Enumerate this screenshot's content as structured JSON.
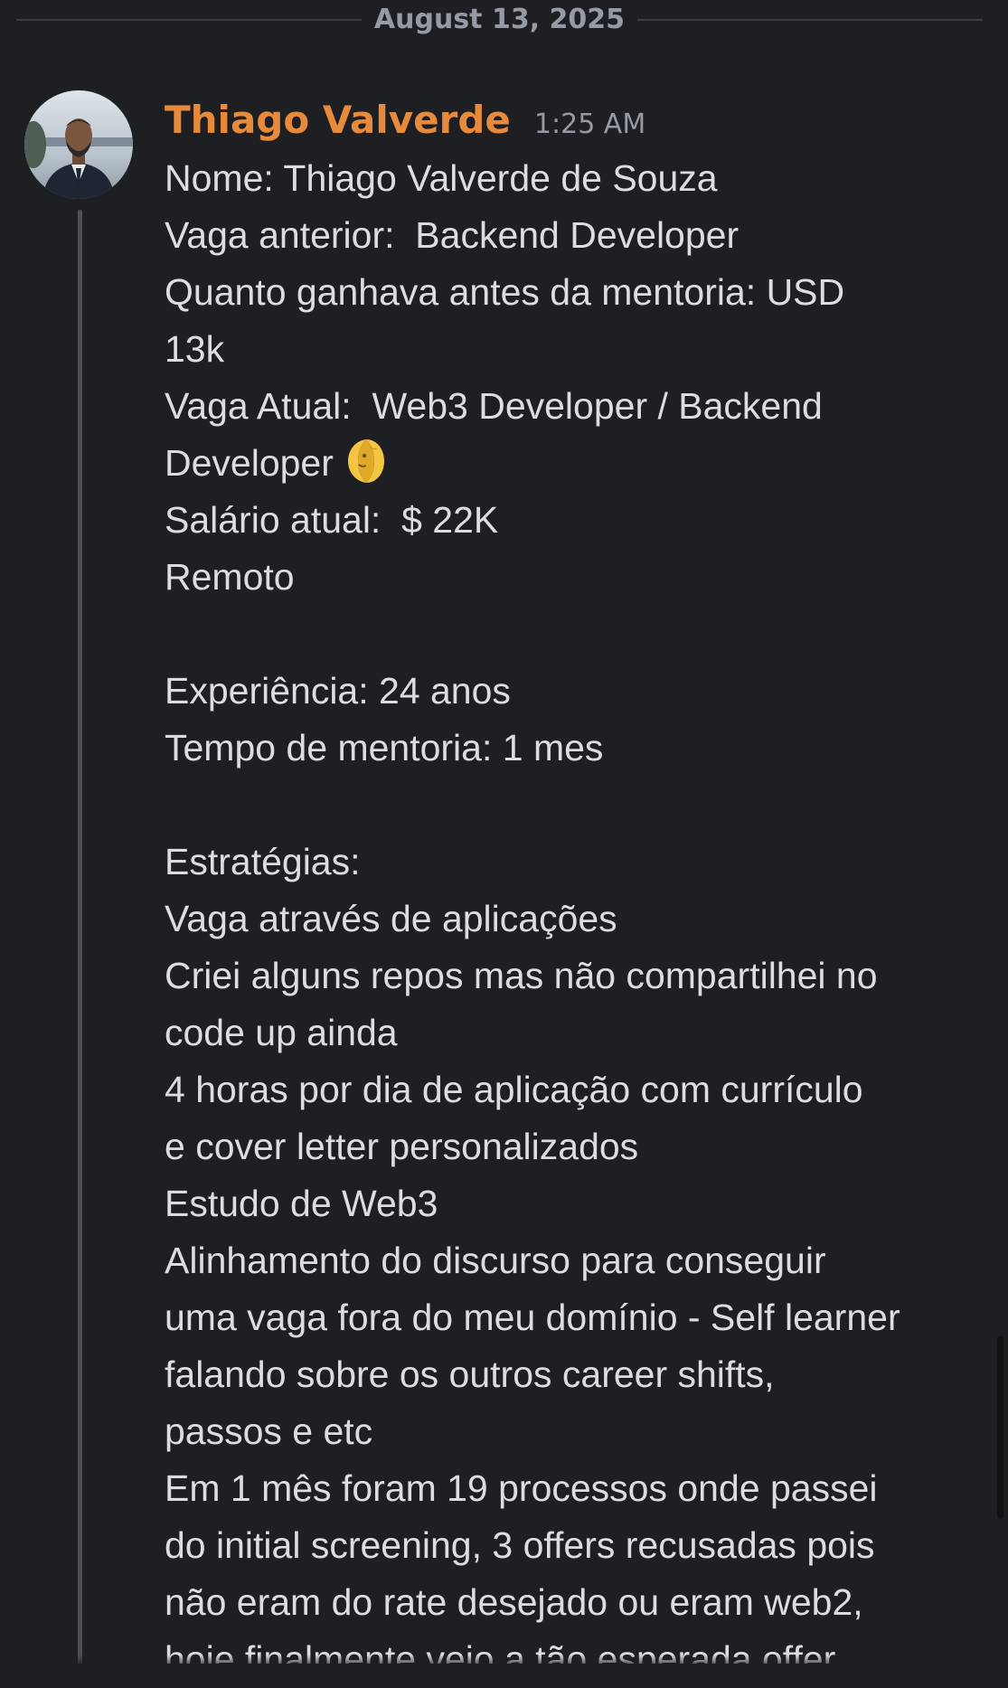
{
  "date_divider": "August 13, 2025",
  "message": {
    "author": "Thiago Valverde",
    "timestamp": "1:25 AM",
    "author_color": "#e78a3c",
    "avatar": "avatar-photo",
    "lines": [
      "Nome: Thiago Valverde de Souza",
      "Vaga anterior:  Backend Developer",
      "Quanto ganhava antes da mentoria: USD",
      "13k",
      "Vaga Atual:  Web3 Developer / Backend",
      "Developer",
      "Salário atual:  $ 22K",
      "Remoto",
      "",
      "Experiência: 24 anos",
      "Tempo de mentoria: 1 mes",
      "",
      "Estratégias:",
      "Vaga através de aplicações",
      "Criei alguns repos mas não compartilhei no",
      "code up ainda",
      "4 horas por dia de aplicação com currículo",
      "e cover letter personalizados",
      "Estudo de Web3",
      "Alinhamento do discurso para conseguir",
      "uma vaga fora do meu domínio - Self learner",
      "falando sobre os outros career shifts,",
      "passos e etc",
      "Em 1 mês foram 19 processos onde passei",
      "do initial screening, 3 offers recusadas pois",
      "não eram do rate desejado ou eram web2,",
      "hoje finalmente veio a tão esperada offer"
    ],
    "inline_emoji": "last-quarter-moon-face-icon"
  }
}
